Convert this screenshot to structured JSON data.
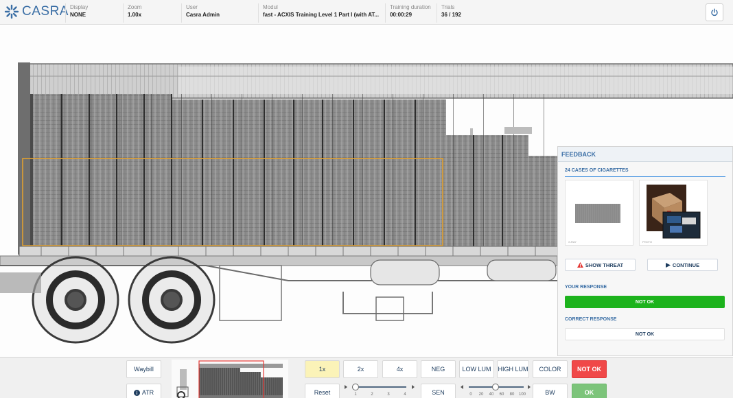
{
  "app": {
    "logo_text": "CASRA"
  },
  "header": {
    "fields": [
      {
        "label": "Display",
        "value": "NONE"
      },
      {
        "label": "Zoom",
        "value": "1.00x"
      },
      {
        "label": "User",
        "value": "Casra Admin"
      },
      {
        "label": "Modul",
        "value": "fast - ACXIS Training Level 1 Part I (with AT..."
      },
      {
        "label": "Training duration",
        "value": "00:00:29"
      },
      {
        "label": "Trials",
        "value": "36 / 192"
      }
    ],
    "power_icon": "power-icon"
  },
  "feedback": {
    "title": "FEEDBACK",
    "case_title": "24 CASES OF CIGARETTES",
    "image_captions": [
      "X-RAY",
      "PHOTO"
    ],
    "show_threat_label": "SHOW THREAT",
    "continue_label": "CONTINUE",
    "your_response_label": "YOUR RESPONSE",
    "your_response_value": "NOT OK",
    "correct_response_label": "CORRECT RESPONSE",
    "correct_response_value": "NOT OK",
    "colors": {
      "accent": "#3a6ea5",
      "ok_green": "#1db31d",
      "warning_red": "#e53935"
    }
  },
  "toolbar": {
    "waybill": "Waybill",
    "atr": "ATR",
    "zoom_1x": "1x",
    "zoom_2x": "2x",
    "zoom_4x": "4x",
    "reset": "Reset",
    "zoom_slider_ticks": [
      "1",
      "2",
      "3",
      "4"
    ],
    "neg": "NEG",
    "sen": "SEN",
    "low_lum": "LOW LUM",
    "high_lum": "HIGH LUM",
    "lum_slider_ticks": [
      "0",
      "20",
      "40",
      "60",
      "80",
      "100"
    ],
    "color": "COLOR",
    "bw": "BW",
    "not_ok": "NOT OK",
    "ok": "OK",
    "colors": {
      "not_ok_bg": "#f04848",
      "ok_bg": "#7cc47a",
      "active_bg": "#fbf3b8"
    }
  }
}
